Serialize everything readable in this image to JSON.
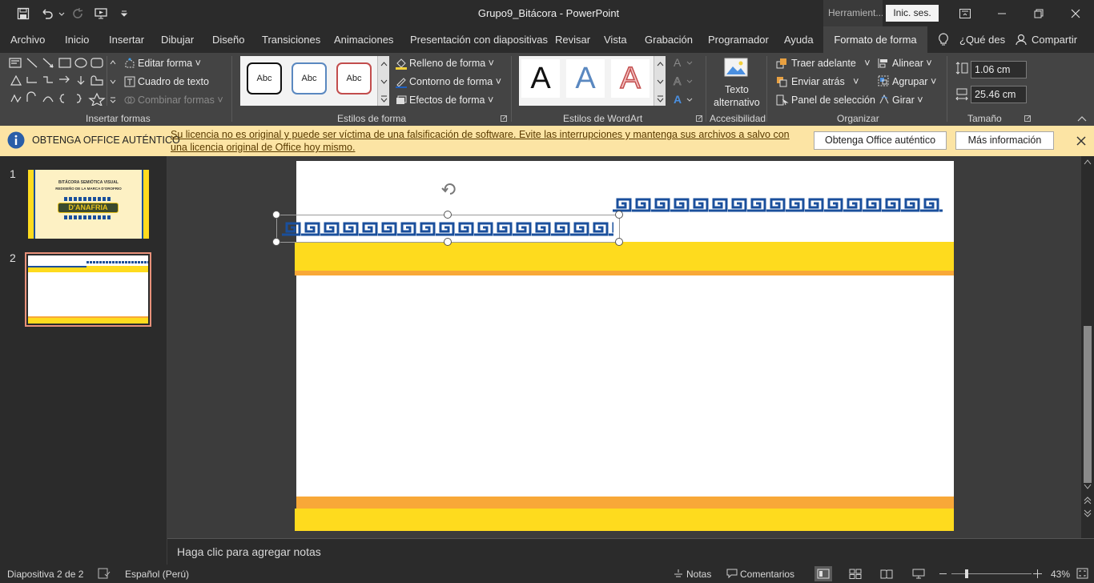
{
  "window": {
    "title": "Grupo9_Bitácora  -  PowerPoint",
    "contextual_label": "Herramient...",
    "signin_label": "Inic. ses."
  },
  "tabs": [
    "Archivo",
    "Inicio",
    "Insertar",
    "Dibujar",
    "Diseño",
    "Transiciones",
    "Animaciones",
    "Presentación con diapositivas",
    "Revisar",
    "Vista",
    "Grabación",
    "Programador",
    "Ayuda",
    "Formato de forma"
  ],
  "tellme": "¿Qué des",
  "share": "Compartir",
  "ribbon": {
    "insert_shapes": {
      "edit_shape": "Editar forma",
      "text_box": "Cuadro de texto",
      "merge_shapes": "Combinar formas",
      "group_label": "Insertar formas"
    },
    "shape_styles": {
      "swatch_text": "Abc",
      "fill": "Relleno de forma",
      "outline": "Contorno de forma",
      "effects": "Efectos de forma",
      "group_label": "Estilos de forma"
    },
    "wordart": {
      "letter": "A",
      "group_label": "Estilos de WordArt"
    },
    "accessibility": {
      "alt_text_line1": "Texto",
      "alt_text_line2": "alternativo",
      "group_label": "Accesibilidad"
    },
    "arrange": {
      "bring_forward": "Traer adelante",
      "send_backward": "Enviar atrás",
      "selection_pane": "Panel de selección",
      "align": "Alinear",
      "group": "Agrupar",
      "rotate": "Girar",
      "group_label": "Organizar"
    },
    "size": {
      "height": "1.06 cm",
      "width": "25.46 cm",
      "group_label": "Tamaño"
    }
  },
  "banner": {
    "title": "OBTENGA OFFICE AUTÉNTICO",
    "message": "Su licencia no es original y puede ser víctima de una falsificación de software. Evite las interrupciones y mantenga sus archivos a salvo con una licencia original de Office hoy mismo.",
    "btn_genuine": "Obtenga Office auténtico",
    "btn_more": "Más información"
  },
  "thumbnails": [
    {
      "number": "1",
      "line1": "BITÁCORA SEMIÓTICA VISUAL",
      "line2": "REDISEÑO DE LA MARCA D'OROFRIO",
      "logo": "D'ANAFRIA"
    },
    {
      "number": "2"
    }
  ],
  "notes_placeholder": "Haga clic para agregar notas",
  "status": {
    "slide": "Diapositiva 2 de 2",
    "language": "Español (Perú)",
    "notes": "Notas",
    "comments": "Comentarios",
    "zoom": "43%"
  },
  "colors": {
    "accent_yellow": "#fedb1e",
    "accent_orange": "#f8a838",
    "pattern_blue": "#1a4f9c",
    "tab_accent": "#444444"
  }
}
